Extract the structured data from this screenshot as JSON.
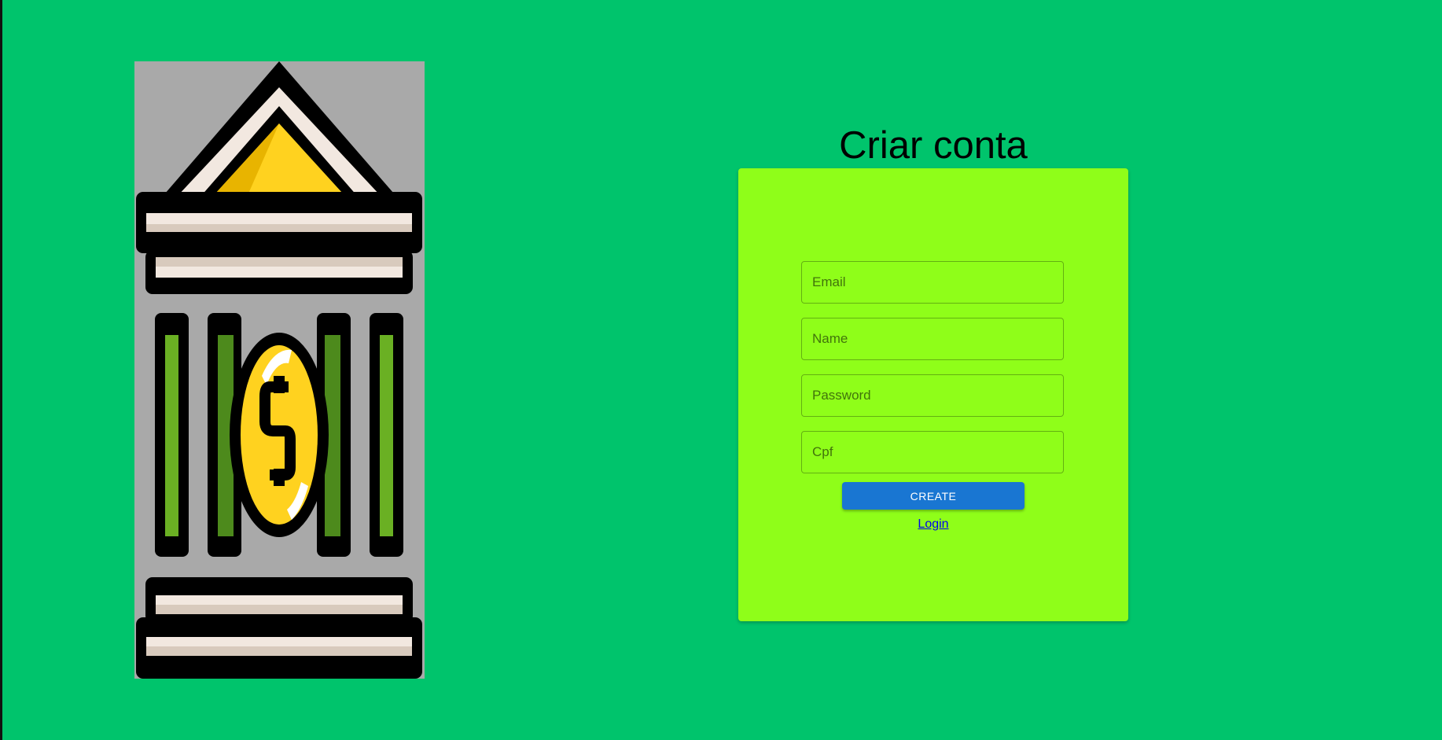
{
  "page": {
    "background_color": "#00c46c",
    "title": "Criar conta"
  },
  "logo": {
    "icon": "bank-dollar-icon",
    "background_color": "#a9a9a9"
  },
  "form": {
    "card_color": "#8ffe19",
    "fields": {
      "email": {
        "placeholder": "Email",
        "value": ""
      },
      "name": {
        "placeholder": "Name",
        "value": ""
      },
      "password": {
        "placeholder": "Password",
        "value": ""
      },
      "cpf": {
        "placeholder": "Cpf",
        "value": ""
      }
    },
    "create_button": {
      "label": "CREATE",
      "color": "#1976d2"
    },
    "login_link": {
      "label": "Login"
    }
  }
}
